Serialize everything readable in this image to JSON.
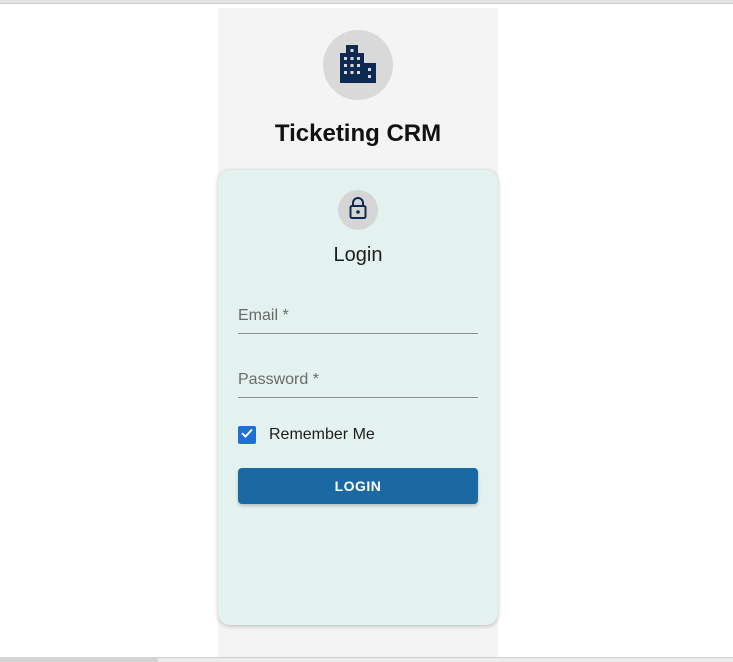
{
  "app": {
    "title": "Ticketing CRM",
    "logo_icon": "building-icon"
  },
  "login": {
    "icon": "lock-icon",
    "title": "Login",
    "email_placeholder": "Email *",
    "email_value": "",
    "password_placeholder": "Password *",
    "password_value": "",
    "remember_label": "Remember Me",
    "remember_checked": true,
    "submit_label": "LOGIN"
  },
  "colors": {
    "brand_dark": "#0f2a52",
    "button": "#1b69a3",
    "checkbox": "#1e6fd6",
    "card_bg": "#e4f2ef",
    "column_bg": "#f4f4f4"
  }
}
